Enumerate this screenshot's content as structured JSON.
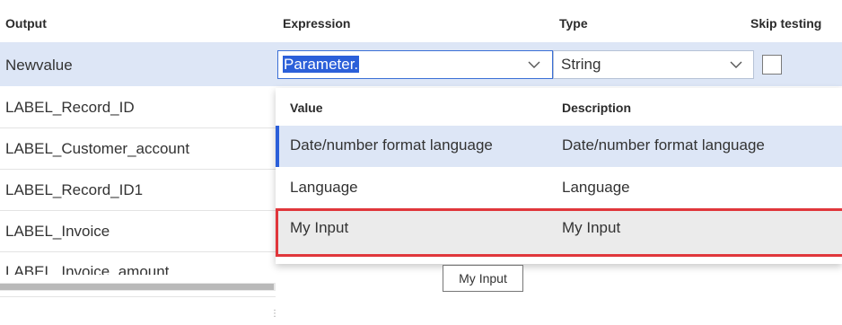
{
  "grid": {
    "headers": {
      "output": "Output",
      "expression": "Expression",
      "type": "Type",
      "skip_testing": "Skip testing"
    },
    "rows": [
      {
        "output": "Newvalue"
      },
      {
        "output": "LABEL_Record_ID"
      },
      {
        "output": "LABEL_Customer_account"
      },
      {
        "output": "LABEL_Record_ID1"
      },
      {
        "output": "LABEL_Invoice"
      },
      {
        "output": "LABEL_Invoice_amount"
      }
    ],
    "selected_row": {
      "expression_value": "Parameter.",
      "type_value": "String",
      "skip_testing_checked": false
    }
  },
  "dropdown": {
    "headers": {
      "value": "Value",
      "description": "Description"
    },
    "items": [
      {
        "value": "Date/number format language",
        "description": "Date/number format language"
      },
      {
        "value": "Language",
        "description": "Language"
      },
      {
        "value": "My Input",
        "description": "My Input"
      }
    ]
  },
  "tooltip": {
    "text": "My Input"
  },
  "colors": {
    "selection_bg": "#dde6f6",
    "accent": "#2b5fd9",
    "highlight_border": "#e0363b"
  }
}
